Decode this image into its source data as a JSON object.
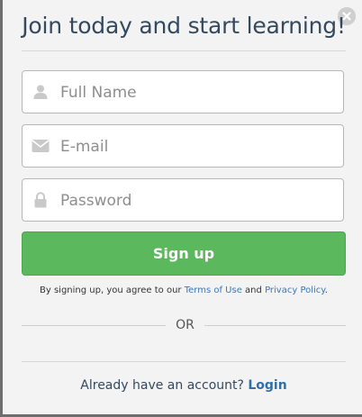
{
  "modal": {
    "title": "Join today and start learning!",
    "close_icon": "close-icon"
  },
  "form": {
    "fields": [
      {
        "name": "full-name",
        "icon": "user-icon",
        "placeholder": "Full Name",
        "value": ""
      },
      {
        "name": "email",
        "icon": "envelope-icon",
        "placeholder": "E-mail",
        "value": ""
      },
      {
        "name": "password",
        "icon": "lock-icon",
        "placeholder": "Password",
        "value": ""
      }
    ],
    "signup_label": "Sign up"
  },
  "terms": {
    "prefix": "By signing up, you agree to our",
    "terms_link": "Terms of Use",
    "and": "and",
    "privacy_link": "Privacy Policy",
    "suffix": "."
  },
  "divider": {
    "or_label": "OR"
  },
  "footer": {
    "question": "Already have an account?",
    "login_link": "Login"
  },
  "colors": {
    "primary_button": "#5cb85c",
    "link": "#3a78b5",
    "title": "#34495e"
  }
}
